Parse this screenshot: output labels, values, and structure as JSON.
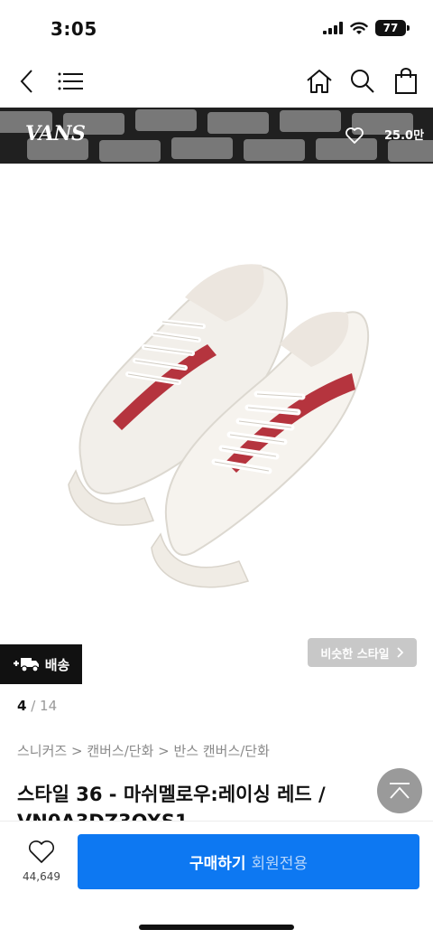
{
  "status_bar": {
    "time": "3:05",
    "battery": "77"
  },
  "nav": {
    "icons": [
      "chevron-left-icon",
      "menu-icon",
      "home-icon",
      "search-icon",
      "shopping-bag-icon"
    ]
  },
  "banner": {
    "brand": "VANS",
    "likes": "25.0만"
  },
  "product": {
    "image_icon": "sneaker-pair-icon",
    "accent_color": "#b5343e",
    "title": "스타일 36 - 마쉬멜로우:레이싱 레드 / VN0A3DZ3OXS1"
  },
  "delivery_label": "배송",
  "similar_label": "비슷한 스타일",
  "pager": {
    "current": "4",
    "separator": " / ",
    "total": "14"
  },
  "breadcrumb": {
    "items": [
      "스니커즈",
      "캔버스/단화",
      "반스 캔버스/단화"
    ],
    "sep": " > "
  },
  "bottom": {
    "wish_count": "44,649",
    "buy_label": "구매하기",
    "buy_sub": "회원전용",
    "buy_color": "#0d78f2"
  }
}
